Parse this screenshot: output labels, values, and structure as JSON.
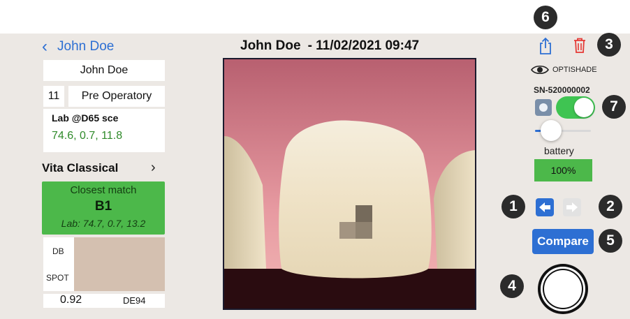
{
  "nav": {
    "back_label": "John Doe",
    "title_name": "John Doe",
    "title_datetime": "- 11/02/2021 09:47"
  },
  "patient": {
    "name": "John Doe",
    "tooth_number": "11",
    "stage": "Pre Operatory"
  },
  "lab": {
    "title": "Lab @D65 sce",
    "value": "74.6, 0.7, 11.8"
  },
  "shade_guide": {
    "label": "Vita Classical",
    "chevron": "›"
  },
  "closest_match": {
    "heading": "Closest match",
    "shade": "B1",
    "lab": "Lab: 74.7, 0.7, 13.2"
  },
  "comparison": {
    "db_label": "DB",
    "spot_label": "SPOT",
    "delta_value": "0.92",
    "delta_label": "DE94",
    "swatch_color": "#d4c0b0"
  },
  "device": {
    "brand": "OPTISHADE",
    "serial": "SN-520000002",
    "battery_label": "battery",
    "battery_value": "100%",
    "toggle_on": true
  },
  "buttons": {
    "compare_label": "Compare"
  },
  "callouts": {
    "b1": "1",
    "b2": "2",
    "b3": "3",
    "b4": "4",
    "b5": "5",
    "b6": "6",
    "b7": "7"
  },
  "colors": {
    "accent_blue": "#2d6fd3",
    "match_green": "#4cb84a",
    "lab_text_green": "#2f8a2a",
    "delete_red": "#e53935",
    "toggle_green": "#3fc452"
  },
  "icons": {
    "share": "share-icon",
    "trash": "trash-icon",
    "eye": "eye-icon",
    "camera": "camera-icon",
    "prev": "arrow-left-icon",
    "next": "arrow-right-icon",
    "shutter": "shutter-icon"
  }
}
